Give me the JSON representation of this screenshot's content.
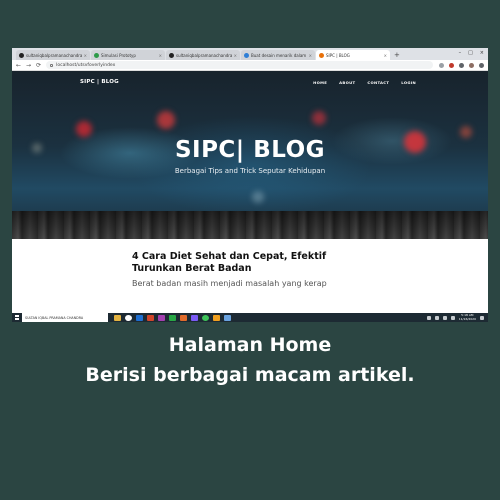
{
  "browser": {
    "tabs": [
      {
        "label": "sultaniqbalpramanachandra.cla",
        "favicon_color": "#222222",
        "active": false
      },
      {
        "label": "Simulasi Prototyp",
        "favicon_color": "#2e9b4a",
        "active": false
      },
      {
        "label": "sultaniqbalpramanachandra.cla",
        "favicon_color": "#222222",
        "active": false
      },
      {
        "label": "Buat desain menarik dalam wa",
        "favicon_color": "#2f7fd6",
        "active": false
      },
      {
        "label": "SIPC | BLOG",
        "favicon_color": "#e8710a",
        "active": true
      }
    ],
    "new_tab": "+",
    "url": "localhost/utsvfoverlyindex",
    "window_controls": [
      "–",
      "□",
      "×"
    ]
  },
  "site": {
    "brand": "SIPC | BLOG",
    "nav": [
      "HOME",
      "ABOUT",
      "CONTACT",
      "LOGIN"
    ],
    "hero_title": "SIPC| BLOG",
    "hero_subtitle": "Berbagai Tips and Trick Seputar Kehidupan",
    "article_title": "4 Cara Diet Sehat dan Cepat, Efektif Turunkan Berat Badan",
    "article_excerpt": "Berat badan masih menjadi masalah yang kerap"
  },
  "taskbar": {
    "search_text": "SULTAN IQBAL PRAMANA CHANDRA",
    "clock_time": "5:18 AM",
    "clock_date": "11/16/2020",
    "app_icon_colors": [
      "#e3b341",
      "#ffffff",
      "#1f6fd1",
      "#d0452b",
      "#a33fb0",
      "#28a745",
      "#e06b2b",
      "#7a5af5",
      "#3ec45a",
      "#f0a020",
      "#6aa3e0"
    ]
  },
  "caption": {
    "line1": "Halaman Home",
    "line2": "Berisi berbagai macam artikel."
  }
}
